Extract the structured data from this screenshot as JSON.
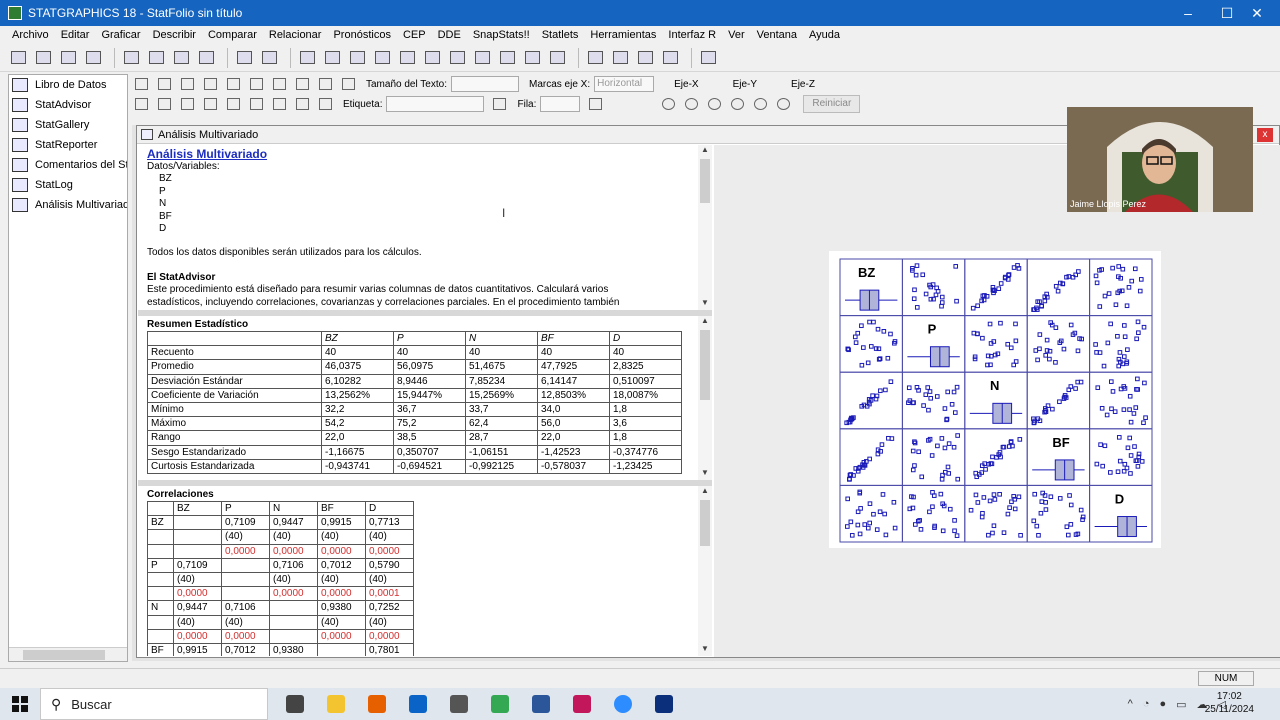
{
  "window": {
    "title": "STATGRAPHICS 18 - StatFolio sin título",
    "minimize": "–",
    "maximize": "☐",
    "close": "✕"
  },
  "menu": [
    "Archivo",
    "Editar",
    "Graficar",
    "Describir",
    "Comparar",
    "Relacionar",
    "Pronósticos",
    "CEP",
    "DDE",
    "SnapStats!!",
    "Statlets",
    "Herramientas",
    "Interfaz R",
    "Ver",
    "Ventana",
    "Ayuda"
  ],
  "sidebar": [
    {
      "label": "Libro de Datos",
      "icon": "grid-icon"
    },
    {
      "label": "StatAdvisor",
      "icon": "advisor-icon"
    },
    {
      "label": "StatGallery",
      "icon": "gallery-icon"
    },
    {
      "label": "StatReporter",
      "icon": "reporter-icon"
    },
    {
      "label": "Comentarios del StatFolio",
      "icon": "comments-icon"
    },
    {
      "label": "StatLog",
      "icon": "log-icon"
    },
    {
      "label": "Análisis Multivariado",
      "icon": "analysis-icon"
    }
  ],
  "graph_toolbar": {
    "text_size_label": "Tamaño del Texto:",
    "axis_marks_label": "Marcas eje X:",
    "axis_marks_value": "Horizontal",
    "label_label": "Etiqueta:",
    "row_label": "Fila:",
    "axis_x": "Eje-X",
    "axis_y": "Eje-Y",
    "axis_z": "Eje-Z",
    "reset": "Reiniciar"
  },
  "analysis_window": {
    "title": "Análisis Multivariado",
    "close": "x"
  },
  "summary": {
    "heading": "Análisis Multivariado",
    "data_label": "Datos/Variables:",
    "variables": [
      "BZ",
      "P",
      "N",
      "BF",
      "D"
    ],
    "note": "Todos los datos disponibles serán utilizados para los cálculos.",
    "advisor_title": "El StatAdvisor",
    "advisor_line1": "Este procedimiento está diseñado para resumir varias columnas de datos cuantitativos.  Calculará varios",
    "advisor_line2": "estadísticos, incluyendo correlaciones, covarianzas y correlaciones parciales.  En el procedimiento también"
  },
  "stats": {
    "title": "Resumen Estadístico",
    "columns": [
      "",
      "BZ",
      "P",
      "N",
      "BF",
      "D"
    ],
    "rows": [
      [
        "Recuento",
        "40",
        "40",
        "40",
        "40",
        "40"
      ],
      [
        "Promedio",
        "46,0375",
        "56,0975",
        "51,4675",
        "47,7925",
        "2,8325"
      ],
      [
        "Desviación Estándar",
        "6,10282",
        "8,9446",
        "7,85234",
        "6,14147",
        "0,510097"
      ],
      [
        "Coeficiente de Variación",
        "13,2562%",
        "15,9447%",
        "15,2569%",
        "12,8503%",
        "18,0087%"
      ],
      [
        "Mínimo",
        "32,2",
        "36,7",
        "33,7",
        "34,0",
        "1,8"
      ],
      [
        "Máximo",
        "54,2",
        "75,2",
        "62,4",
        "56,0",
        "3,6"
      ],
      [
        "Rango",
        "22,0",
        "38,5",
        "28,7",
        "22,0",
        "1,8"
      ],
      [
        "Sesgo Estandarizado",
        "-1,16675",
        "0,350707",
        "-1,06151",
        "-1,42523",
        "-0,374776"
      ],
      [
        "Curtosis Estandarizada",
        "-0,943741",
        "-0,694521",
        "-0,992125",
        "-0,578037",
        "-1,23425"
      ]
    ]
  },
  "correlations": {
    "title": "Correlaciones",
    "columns": [
      "",
      "BZ",
      "P",
      "N",
      "BF",
      "D"
    ],
    "rows": [
      {
        "cells": [
          "BZ",
          "",
          "0,7109",
          "0,9447",
          "0,9915",
          "0,7713"
        ],
        "kind": "r"
      },
      {
        "cells": [
          "",
          "",
          "(40)",
          "(40)",
          "(40)",
          "(40)"
        ],
        "kind": "n"
      },
      {
        "cells": [
          "",
          "",
          "0,0000",
          "0,0000",
          "0,0000",
          "0,0000"
        ],
        "kind": "p"
      },
      {
        "cells": [
          "P",
          "0,7109",
          "",
          "0,7106",
          "0,7012",
          "0,5790"
        ],
        "kind": "r"
      },
      {
        "cells": [
          "",
          "(40)",
          "",
          "(40)",
          "(40)",
          "(40)"
        ],
        "kind": "n"
      },
      {
        "cells": [
          "",
          "0,0000",
          "",
          "0,0000",
          "0,0000",
          "0,0001"
        ],
        "kind": "p"
      },
      {
        "cells": [
          "N",
          "0,9447",
          "0,7106",
          "",
          "0,9380",
          "0,7252"
        ],
        "kind": "r"
      },
      {
        "cells": [
          "",
          "(40)",
          "(40)",
          "",
          "(40)",
          "(40)"
        ],
        "kind": "n"
      },
      {
        "cells": [
          "",
          "0,0000",
          "0,0000",
          "",
          "0,0000",
          "0,0000"
        ],
        "kind": "p"
      },
      {
        "cells": [
          "BF",
          "0,9915",
          "0,7012",
          "0,9380",
          "",
          "0,7801"
        ],
        "kind": "r"
      }
    ]
  },
  "matrix": {
    "variables": [
      "BZ",
      "P",
      "N",
      "BF",
      "D"
    ],
    "point_color": "#1a1ab8",
    "box_color": "#b0b4d8"
  },
  "status": {
    "num": "NUM"
  },
  "webcam": {
    "name": "Jaime Llopis Perez"
  },
  "taskbar": {
    "search_placeholder": "Buscar",
    "apps": [
      {
        "name": "task-view-icon",
        "color": "#444"
      },
      {
        "name": "file-explorer-icon",
        "color": "#f4c430"
      },
      {
        "name": "firefox-icon",
        "color": "#e66000"
      },
      {
        "name": "outlook-icon",
        "color": "#0a64c8"
      },
      {
        "name": "settings-icon",
        "color": "#555"
      },
      {
        "name": "chrome-icon",
        "color": "#34a853"
      },
      {
        "name": "word-icon",
        "color": "#2b579a"
      },
      {
        "name": "camera-icon",
        "color": "#c2185b"
      },
      {
        "name": "zoom-icon",
        "color": "#2d8cff"
      },
      {
        "name": "statgraphics-icon",
        "color": "#0b2f7a"
      }
    ],
    "time": "17:02",
    "date": "25/11/2024"
  }
}
